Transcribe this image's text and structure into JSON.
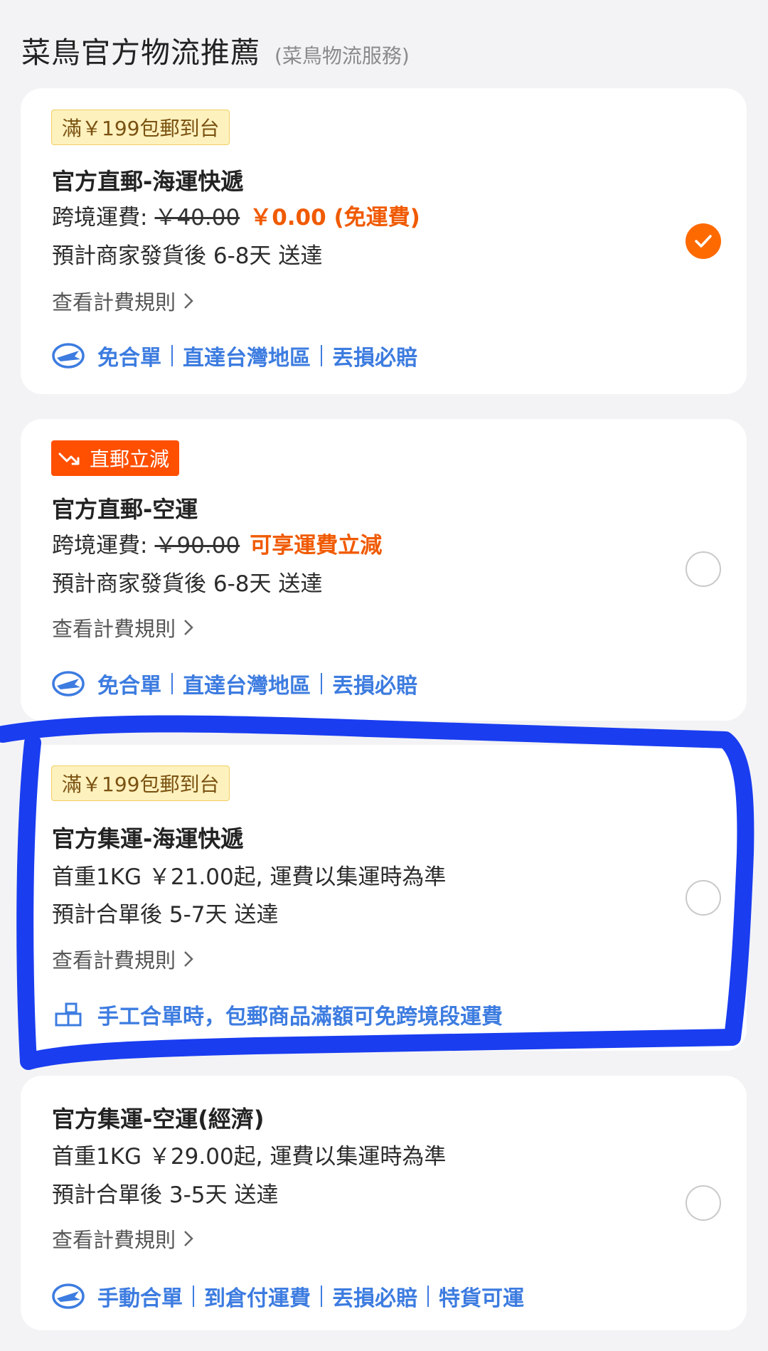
{
  "header": {
    "title": "菜鳥官方物流推薦",
    "subtitle": "(菜鳥物流服務)"
  },
  "options": [
    {
      "badge": "滿￥199包郵到台",
      "title": "官方直郵-海運快遞",
      "fee_label": "跨境運費:",
      "fee_original": "￥40.00",
      "fee_final": "￥0.00 (免運費)",
      "delivery": "預計商家發貨後 6-8天 送達",
      "rules_link": "查看計費規則",
      "features": [
        "免合單",
        "直達台灣地區",
        "丟損必賠"
      ],
      "selected": true
    },
    {
      "badge": "直郵立減",
      "title": "官方直郵-空運",
      "fee_label": "跨境運費:",
      "fee_original": "￥90.00",
      "fee_final": "可享運費立減",
      "delivery": "預計商家發貨後 6-8天 送達",
      "rules_link": "查看計費規則",
      "features": [
        "免合單",
        "直達台灣地區",
        "丟損必賠"
      ],
      "selected": false
    },
    {
      "badge": "滿￥199包郵到台",
      "title": "官方集運-海運快遞",
      "fee_text": "首重1KG ￥21.00起, 運費以集運時為準",
      "delivery": "預計合單後 5-7天 送達",
      "rules_link": "查看計費規則",
      "note": "手工合單時，包郵商品滿額可免跨境段運費",
      "selected": false
    },
    {
      "title": "官方集運-空運(經濟)",
      "fee_text": "首重1KG ￥29.00起, 運費以集運時為準",
      "delivery": "預計合單後 3-5天 送達",
      "rules_link": "查看計費規則",
      "features": [
        "手動合單",
        "到倉付運費",
        "丟損必賠",
        "特貨可運"
      ],
      "selected": false
    }
  ],
  "colors": {
    "accent_orange": "#ff6a00",
    "link_blue": "#3d7ce0",
    "annotation_blue": "#1a3df0"
  }
}
